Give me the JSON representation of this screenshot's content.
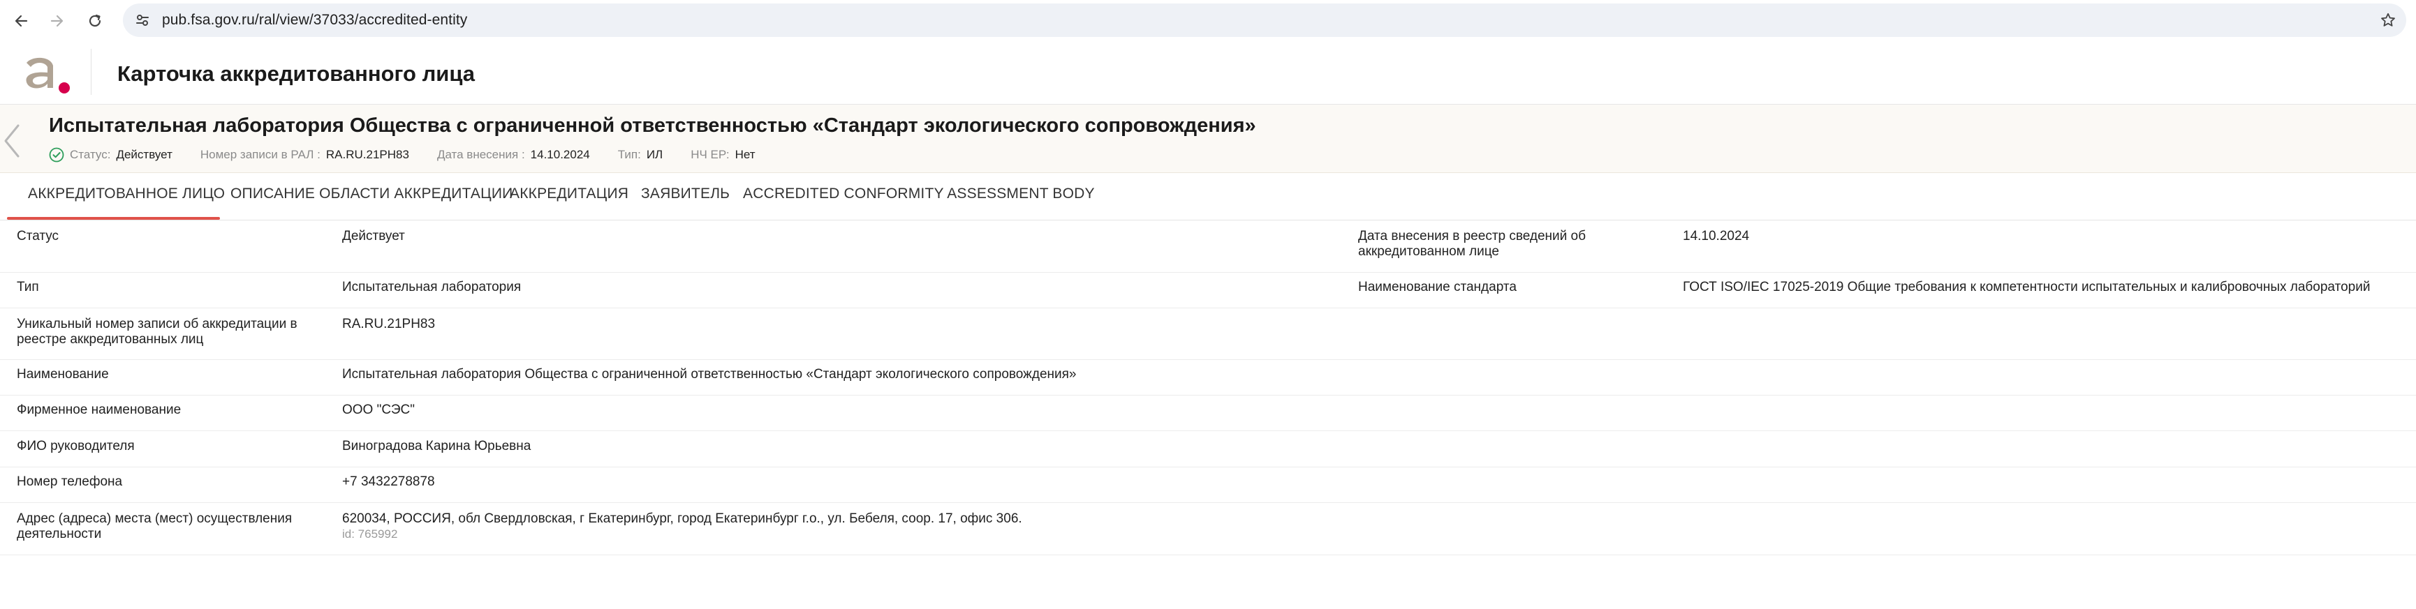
{
  "browser": {
    "url": "pub.fsa.gov.ru/ral/view/37033/accredited-entity"
  },
  "header": {
    "title": "Карточка аккредитованного лица"
  },
  "entity": {
    "name": "Испытательная лаборатория Общества с ограниченной ответственностью «Стандарт экологического сопровождения»",
    "status_label": "Статус:",
    "status_value": "Действует",
    "record_label": "Номер записи в РАЛ :",
    "record_value": "RA.RU.21PH83",
    "date_label": "Дата внесения :",
    "date_value": "14.10.2024",
    "type_label": "Тип:",
    "type_value": "ИЛ",
    "nch_label": "НЧ ЕР:",
    "nch_value": "Нет"
  },
  "tabs": [
    {
      "label": "АККРЕДИТОВАННОЕ ЛИЦО",
      "active": true
    },
    {
      "label": "ОПИСАНИЕ ОБЛАСТИ АККРЕДИТАЦИИ",
      "active": false
    },
    {
      "label": "АККРЕДИТАЦИЯ",
      "active": false
    },
    {
      "label": "ЗАЯВИТЕЛЬ",
      "active": false
    },
    {
      "label": "ACCREDITED CONFORMITY ASSESSMENT BODY",
      "active": false
    }
  ],
  "details": {
    "rows": [
      {
        "label": "Статус",
        "value": "Действует"
      },
      {
        "label": "Тип",
        "value": "Испытательная лаборатория"
      },
      {
        "label": "Уникальный номер записи об аккредитации в реестре аккредитованных лиц",
        "value": "RA.RU.21PH83"
      },
      {
        "label": "Наименование",
        "value": "Испытательная лаборатория Общества с ограниченной ответственностью «Стандарт экологического сопровождения»"
      },
      {
        "label": "Фирменное наименование",
        "value": "ООО \"СЭС\""
      },
      {
        "label": "ФИО руководителя",
        "value": "Виноградова Карина Юрьевна"
      },
      {
        "label": "Номер телефона",
        "value": "+7 3432278878"
      },
      {
        "label": "Адрес (адреса) места (мест) осуществления деятельности",
        "value": "620034, РОССИЯ, обл Свердловская, г Екатеринбург, город Екатеринбург г.о., ул. Бебеля, соор. 17, офис 306.",
        "sub": "id: 765992"
      }
    ],
    "right": [
      {
        "label": "Дата внесения в реестр сведений об аккредитованном лице",
        "value": "14.10.2024"
      },
      {
        "label": "Наименование стандарта",
        "value": "ГОСТ ISO/IEC 17025-2019 Общие требования к компетентности испытательных и калибровочных лабораторий"
      }
    ]
  },
  "colors": {
    "accent": "#e0524a",
    "logo_dot": "#d6004c",
    "logo": "#b0a394",
    "status_ok": "#2e9e5b",
    "banner_bg": "#fbf9f5"
  },
  "icons": [
    "back-arrow-icon",
    "forward-arrow-icon",
    "reload-icon",
    "site-settings-icon",
    "bookmark-star-icon",
    "logo",
    "chevron-left-icon",
    "check-circle-icon"
  ]
}
